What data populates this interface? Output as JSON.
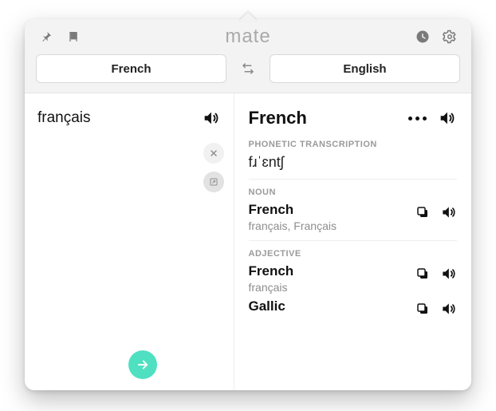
{
  "app": {
    "title": "mate"
  },
  "langs": {
    "source": "French",
    "target": "English"
  },
  "source": {
    "text": "français"
  },
  "result": {
    "headline": "French",
    "phonetic_label": "Phonetic transcription",
    "phonetic": "fɹˈɛntʃ",
    "sections": [
      {
        "label": "Noun",
        "entries": [
          {
            "head": "French",
            "sub": "français, Français"
          }
        ]
      },
      {
        "label": "Adjective",
        "entries": [
          {
            "head": "French",
            "sub": "français"
          },
          {
            "head": "Gallic",
            "sub": ""
          }
        ]
      }
    ]
  }
}
